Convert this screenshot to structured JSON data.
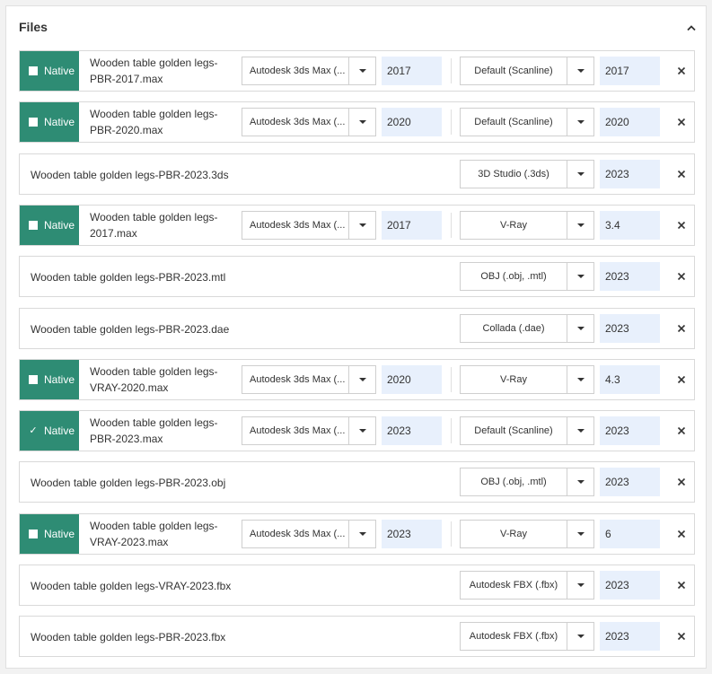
{
  "panel": {
    "title": "Files"
  },
  "native_label": "Native",
  "colors": {
    "native_bg": "#2e8c74",
    "version_bg": "#e8f0fc"
  },
  "files": [
    {
      "native": true,
      "checked": false,
      "name": "Wooden table golden legs-PBR-2017.max",
      "app": "Autodesk 3ds Max (...",
      "app_version": "2017",
      "renderer": "Default (Scanline)",
      "renderer_version": "2017"
    },
    {
      "native": true,
      "checked": false,
      "name": "Wooden table golden legs-PBR-2020.max",
      "app": "Autodesk 3ds Max (...",
      "app_version": "2020",
      "renderer": "Default (Scanline)",
      "renderer_version": "2020"
    },
    {
      "native": false,
      "name": "Wooden table golden legs-PBR-2023.3ds",
      "renderer": "3D Studio (.3ds)",
      "renderer_version": "2023"
    },
    {
      "native": true,
      "checked": false,
      "name": "Wooden table golden legs-2017.max",
      "app": "Autodesk 3ds Max (...",
      "app_version": "2017",
      "renderer": "V-Ray",
      "renderer_version": "3.4"
    },
    {
      "native": false,
      "name": "Wooden table golden legs-PBR-2023.mtl",
      "renderer": "OBJ (.obj, .mtl)",
      "renderer_version": "2023"
    },
    {
      "native": false,
      "name": "Wooden table golden legs-PBR-2023.dae",
      "renderer": "Collada (.dae)",
      "renderer_version": "2023"
    },
    {
      "native": true,
      "checked": false,
      "name": "Wooden table golden legs-VRAY-2020.max",
      "app": "Autodesk 3ds Max (...",
      "app_version": "2020",
      "renderer": "V-Ray",
      "renderer_version": "4.3"
    },
    {
      "native": true,
      "checked": true,
      "name": "Wooden table golden legs-PBR-2023.max",
      "app": "Autodesk 3ds Max (...",
      "app_version": "2023",
      "renderer": "Default (Scanline)",
      "renderer_version": "2023"
    },
    {
      "native": false,
      "name": "Wooden table golden legs-PBR-2023.obj",
      "renderer": "OBJ (.obj, .mtl)",
      "renderer_version": "2023"
    },
    {
      "native": true,
      "checked": false,
      "name": "Wooden table golden legs-VRAY-2023.max",
      "app": "Autodesk 3ds Max (...",
      "app_version": "2023",
      "renderer": "V-Ray",
      "renderer_version": "6"
    },
    {
      "native": false,
      "name": "Wooden table golden legs-VRAY-2023.fbx",
      "renderer": "Autodesk FBX (.fbx)",
      "renderer_version": "2023"
    },
    {
      "native": false,
      "name": "Wooden table golden legs-PBR-2023.fbx",
      "renderer": "Autodesk FBX (.fbx)",
      "renderer_version": "2023"
    }
  ]
}
